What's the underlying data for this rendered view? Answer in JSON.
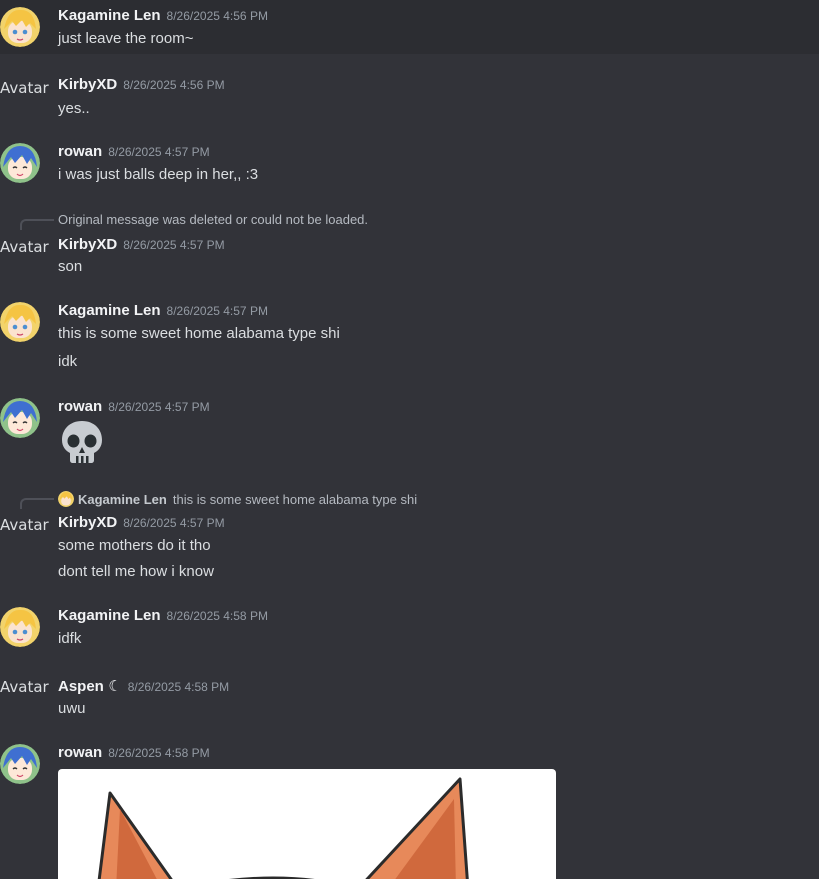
{
  "avatar_alt": "Avatar",
  "messages": [
    {
      "username": "Kagamine Len",
      "timestamp": "8/26/2025 4:56 PM",
      "lines": [
        "just leave the room~"
      ]
    },
    {
      "username": "KirbyXD",
      "timestamp": "8/26/2025 4:56 PM",
      "lines": [
        "yes.."
      ]
    },
    {
      "username": "rowan",
      "timestamp": "8/26/2025 4:57 PM",
      "lines": [
        "i was just balls deep in her,, :3"
      ]
    },
    {
      "reply": {
        "text": "Original message was deleted or could not be loaded."
      },
      "username": "KirbyXD",
      "timestamp": "8/26/2025 4:57 PM",
      "lines": [
        "son"
      ]
    },
    {
      "username": "Kagamine Len",
      "timestamp": "8/26/2025 4:57 PM",
      "lines": [
        "this is some sweet home alabama type shi",
        "idk"
      ]
    },
    {
      "username": "rowan",
      "timestamp": "8/26/2025 4:57 PM",
      "emoji": "skull-emoji"
    },
    {
      "reply": {
        "username": "Kagamine Len",
        "text": "this is some sweet home alabama type shi"
      },
      "username": "KirbyXD",
      "timestamp": "8/26/2025 4:57 PM",
      "lines": [
        "some mothers do it tho",
        "dont tell me how i know"
      ]
    },
    {
      "username": "Kagamine Len",
      "timestamp": "8/26/2025 4:58 PM",
      "lines": [
        "idfk"
      ]
    },
    {
      "username": "Aspen",
      "username_suffix": "☾",
      "timestamp": "8/26/2025 4:58 PM",
      "lines": [
        "uwu"
      ]
    },
    {
      "username": "rowan",
      "timestamp": "8/26/2025 4:58 PM",
      "attachment": "image-attachment"
    }
  ],
  "colors": {
    "background": "#323339",
    "highlight": "#2c2d32",
    "username": "#f2f3f5",
    "timestamp": "#949ba4",
    "text": "#dbdee1",
    "reply_text": "#b5bac1"
  }
}
